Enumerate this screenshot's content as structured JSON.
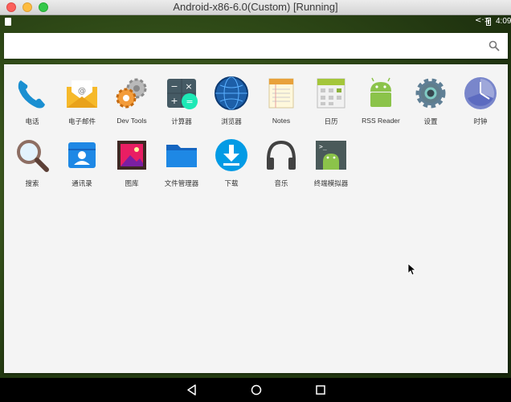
{
  "window": {
    "title": "Android-x86-6.0(Custom) [Running]"
  },
  "status_bar": {
    "time": "4:09",
    "network": "<·>"
  },
  "search": {
    "placeholder": ""
  },
  "apps": [
    {
      "label": "电话",
      "icon": "phone-icon"
    },
    {
      "label": "电子邮件",
      "icon": "email-icon"
    },
    {
      "label": "Dev Tools",
      "icon": "dev-tools-icon"
    },
    {
      "label": "计算器",
      "icon": "calculator-icon"
    },
    {
      "label": "浏览器",
      "icon": "browser-icon"
    },
    {
      "label": "Notes",
      "icon": "notes-icon"
    },
    {
      "label": "日历",
      "icon": "calendar-icon"
    },
    {
      "label": "RSS Reader",
      "icon": "rss-reader-icon"
    },
    {
      "label": "设置",
      "icon": "settings-icon"
    },
    {
      "label": "时钟",
      "icon": "clock-icon"
    },
    {
      "label": "搜索",
      "icon": "search-magnifier-icon"
    },
    {
      "label": "通讯录",
      "icon": "contacts-icon"
    },
    {
      "label": "图库",
      "icon": "gallery-icon"
    },
    {
      "label": "文件管理器",
      "icon": "file-manager-icon"
    },
    {
      "label": "下载",
      "icon": "download-icon"
    },
    {
      "label": "音乐",
      "icon": "music-icon"
    },
    {
      "label": "终端模拟器",
      "icon": "terminal-icon"
    }
  ]
}
